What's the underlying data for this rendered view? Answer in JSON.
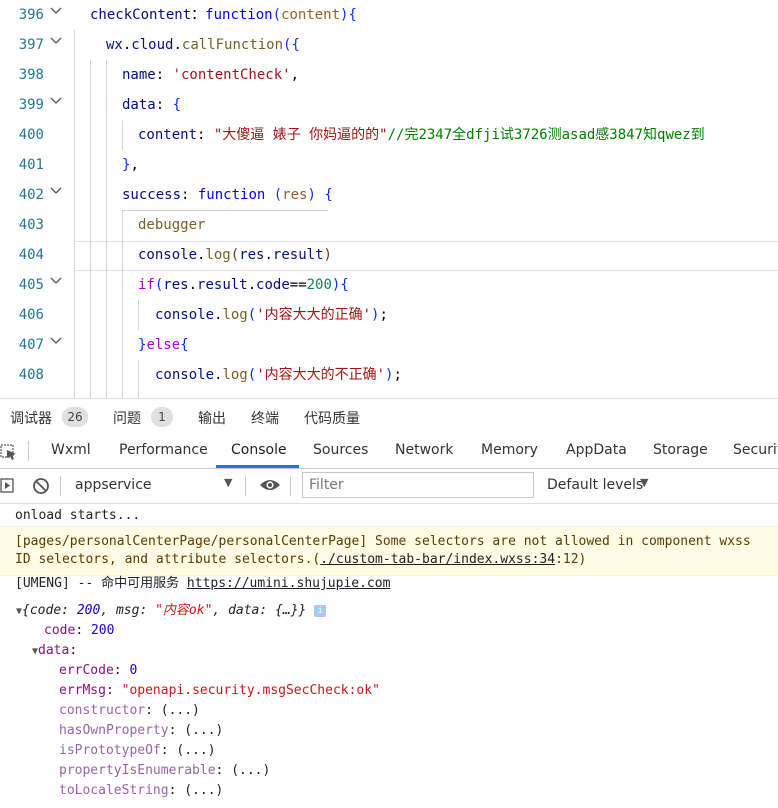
{
  "editor": {
    "lines": [
      {
        "no": "396",
        "parts": [
          [
            "prop",
            "checkContent"
          ],
          [
            "",
            "："
          ],
          [
            "kw",
            "function"
          ],
          [
            "brk",
            "("
          ],
          [
            "prop2",
            "content"
          ],
          [
            "brk",
            ")"
          ],
          [
            "brk",
            "{"
          ]
        ]
      },
      {
        "no": "397",
        "parts": [
          [
            "prop",
            "wx"
          ],
          [
            "",
            "."
          ],
          [
            "prop",
            "cloud"
          ],
          [
            "",
            "."
          ],
          [
            "fn",
            "callFunction"
          ],
          [
            "brk",
            "({"
          ]
        ]
      },
      {
        "no": "398",
        "parts": [
          [
            "prop",
            "name"
          ],
          [
            "",
            ": "
          ],
          [
            "str",
            "'contentCheck'"
          ],
          [
            "",
            ","
          ]
        ]
      },
      {
        "no": "399",
        "parts": [
          [
            "prop",
            "data"
          ],
          [
            "",
            ": "
          ],
          [
            "brk",
            "{"
          ]
        ]
      },
      {
        "no": "400",
        "parts": [
          [
            "prop",
            "content"
          ],
          [
            "",
            ": "
          ],
          [
            "str",
            "\"大傻逼 婊子 你妈逼的的\""
          ],
          [
            "cmt",
            "//完2347全dfji试3726测asad感3847知qwez到"
          ]
        ]
      },
      {
        "no": "401",
        "parts": [
          [
            "brk",
            "}"
          ],
          [
            "",
            ","
          ]
        ]
      },
      {
        "no": "402",
        "parts": [
          [
            "prop",
            "success"
          ],
          [
            "",
            ": "
          ],
          [
            "kw",
            "function"
          ],
          [
            "",
            ""
          ],
          [
            "brk",
            " ("
          ],
          [
            "prop2",
            "res"
          ],
          [
            "brk",
            ")"
          ],
          [
            "",
            ""
          ],
          [
            "brk",
            " {"
          ]
        ]
      },
      {
        "no": "403",
        "parts": [
          [
            "fn",
            "debugger"
          ]
        ]
      },
      {
        "no": "404",
        "parts": [
          [
            "prop",
            "console"
          ],
          [
            "",
            "."
          ],
          [
            "fn",
            "log"
          ],
          [
            "brk3",
            "("
          ],
          [
            "prop",
            "res"
          ],
          [
            "",
            "."
          ],
          [
            "prop",
            "result"
          ],
          [
            "brk3",
            ")"
          ]
        ]
      },
      {
        "no": "405",
        "parts": [
          [
            "ctl",
            "if"
          ],
          [
            "brk",
            "("
          ],
          [
            "prop",
            "res"
          ],
          [
            "",
            "."
          ],
          [
            "prop",
            "result"
          ],
          [
            "",
            "."
          ],
          [
            "prop",
            "code"
          ],
          [
            "",
            "=="
          ],
          [
            "num",
            "200"
          ],
          [
            "brk",
            "){"
          ]
        ]
      },
      {
        "no": "406",
        "parts": [
          [
            "prop",
            "console"
          ],
          [
            "",
            "."
          ],
          [
            "fn",
            "log"
          ],
          [
            "brk",
            "("
          ],
          [
            "str",
            "'内容大大的正确'"
          ],
          [
            "brk",
            ")"
          ],
          [
            "",
            ";"
          ]
        ]
      },
      {
        "no": "407",
        "parts": [
          [
            "brk",
            "}"
          ],
          [
            "ctl",
            "else"
          ],
          [
            "brk",
            "{"
          ]
        ]
      },
      {
        "no": "408",
        "parts": [
          [
            "prop",
            "console"
          ],
          [
            "",
            "."
          ],
          [
            "fn",
            "log"
          ],
          [
            "brk",
            "("
          ],
          [
            "str",
            "'内容大大的不正确'"
          ],
          [
            "brk",
            ")"
          ],
          [
            "",
            ";"
          ]
        ]
      }
    ]
  },
  "panel_tabs": {
    "debugger": "调试器",
    "debugger_count": "26",
    "issues": "问题",
    "issues_count": "1",
    "output": "输出",
    "terminal": "终端",
    "quality": "代码质量"
  },
  "devtools_tabs": [
    "Wxml",
    "Performance",
    "Console",
    "Sources",
    "Network",
    "Memory",
    "AppData",
    "Storage",
    "Securit"
  ],
  "toolbar": {
    "context": "appservice",
    "filter_placeholder": "Filter",
    "levels": "Default levels"
  },
  "console": {
    "line1": "onload starts...",
    "warn_a": "[pages/personalCenterPage/personalCenterPage] Some selectors are not allowed in component wxss",
    "warn_b_prefix": "ID selectors, and attribute selectors.(",
    "warn_b_link": "./custom-tab-bar/index.wxss:34",
    "warn_b_suffix": ":12)",
    "umeng_prefix": "[UMENG] -- 命中可用服务 ",
    "umeng_link": "https://umini.shujupie.com",
    "obj_summary_a": "{code: ",
    "obj_summary_code": "200",
    "obj_summary_b": ", msg: ",
    "obj_summary_msg": "\"内容ok\"",
    "obj_summary_c": ", data: {…}}",
    "info_icon": "i",
    "code_key": "code",
    "code_val": "200",
    "data_key": "data",
    "errcode_key": "errCode",
    "errcode_val": "0",
    "errmsg_key": "errMsg",
    "errmsg_val": "\"openapi.security.msgSecCheck:ok\"",
    "proto": [
      {
        "key": "constructor",
        "val": "(...)"
      },
      {
        "key": "hasOwnProperty",
        "val": "(...)"
      },
      {
        "key": "isPrototypeOf",
        "val": "(...)"
      },
      {
        "key": "propertyIsEnumerable",
        "val": "(...)"
      },
      {
        "key": "toLocaleString",
        "val": "(...)"
      }
    ]
  }
}
